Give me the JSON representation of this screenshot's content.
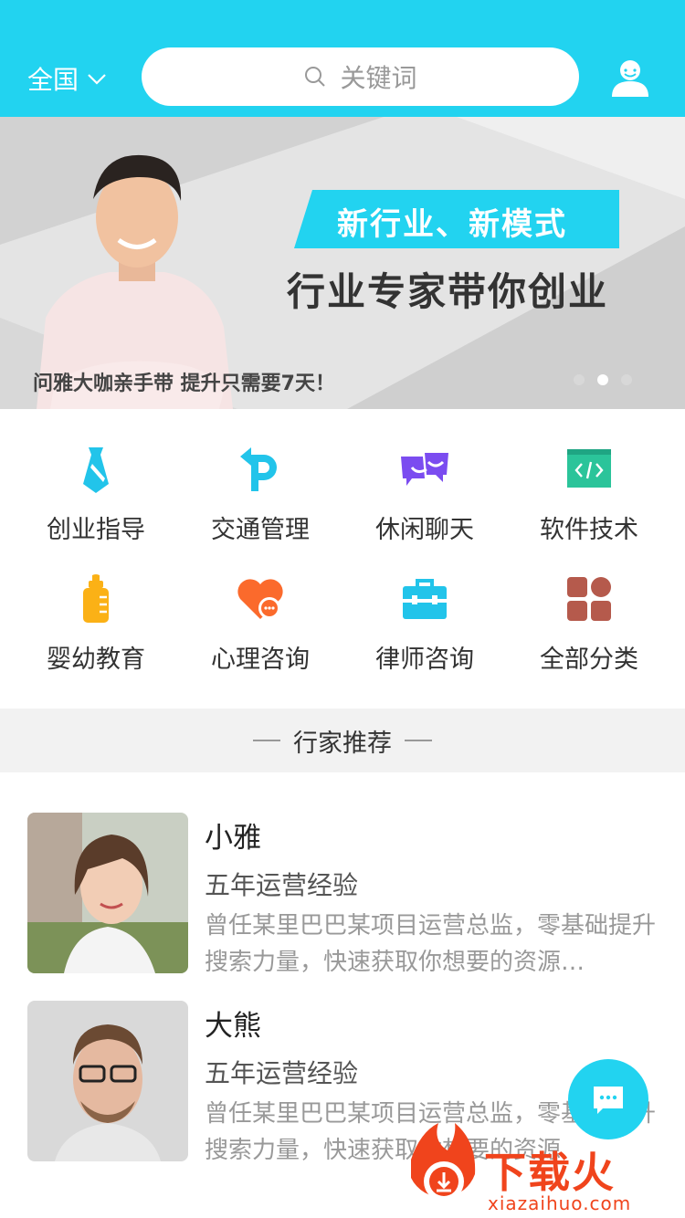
{
  "header": {
    "region_label": "全国",
    "search_placeholder": "关键词"
  },
  "banner": {
    "slogan_line1": "新行业、新模式",
    "slogan_line2": "行业专家带你创业",
    "caption": "问雅大咖亲手带 提升只需要7天！",
    "active_slide": 2,
    "slide_count": 3
  },
  "categories": [
    {
      "label": "创业指导",
      "icon": "tie-icon",
      "color": "#22c4ea"
    },
    {
      "label": "交通管理",
      "icon": "parking-sign-icon",
      "color": "#22c4ea"
    },
    {
      "label": "休闲聊天",
      "icon": "chat-bubbles-icon",
      "color": "#7b4cf0"
    },
    {
      "label": "软件技术",
      "icon": "code-window-icon",
      "color": "#2bc49a"
    },
    {
      "label": "婴幼教育",
      "icon": "baby-bottle-icon",
      "color": "#fbb116"
    },
    {
      "label": "心理咨询",
      "icon": "heart-chat-icon",
      "color": "#fb6a2c"
    },
    {
      "label": "律师咨询",
      "icon": "briefcase-icon",
      "color": "#22c4ea"
    },
    {
      "label": "全部分类",
      "icon": "grid-icon",
      "color": "#b55a4c"
    }
  ],
  "section": {
    "title": "行家推荐"
  },
  "experts": [
    {
      "name": "小雅",
      "title": "五年运营经验",
      "description": "曾任某里巴巴某项目运营总监，零基础提升搜索力量，快速获取你想要的资源…"
    },
    {
      "name": "大熊",
      "title": "五年运营经验",
      "description": "曾任某里巴巴某项目运营总监，零基础提升搜索力量，快速获取你想要的资源"
    }
  ],
  "watermark": {
    "brand": "下载火",
    "url": "xiazaihuo.com"
  },
  "colors": {
    "accent": "#22d3f0"
  }
}
